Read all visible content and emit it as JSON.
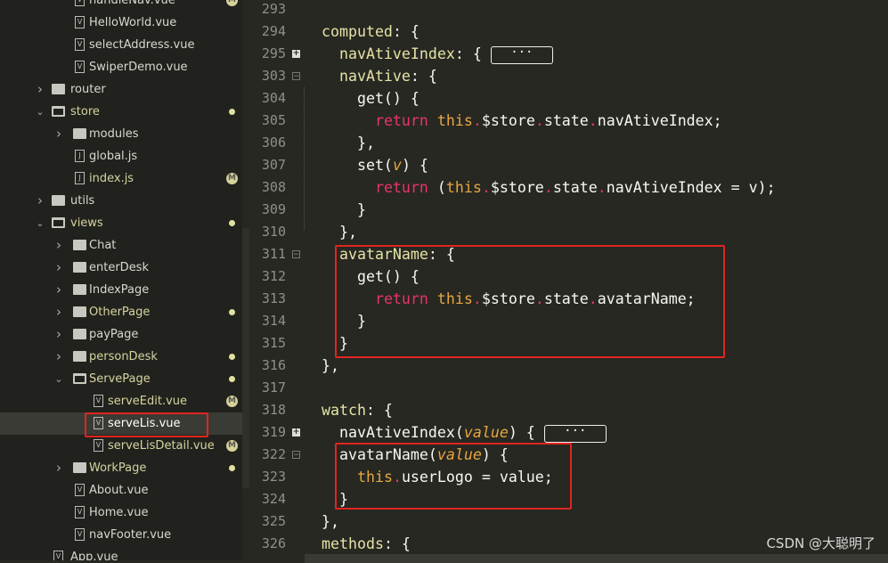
{
  "sidebar": {
    "items": [
      {
        "label": "handleNav.vue",
        "type": "file",
        "depth": 2,
        "badge": "M"
      },
      {
        "label": "HelloWorld.vue",
        "type": "file",
        "depth": 2
      },
      {
        "label": "selectAddress.vue",
        "type": "file",
        "depth": 2
      },
      {
        "label": "SwiperDemo.vue",
        "type": "file",
        "depth": 2
      },
      {
        "label": "router",
        "type": "folder",
        "depth": 1,
        "open": false
      },
      {
        "label": "store",
        "type": "folder",
        "depth": 1,
        "open": true,
        "badge": "dot",
        "modified": true
      },
      {
        "label": "modules",
        "type": "folder",
        "depth": 2,
        "open": false
      },
      {
        "label": "global.js",
        "type": "file",
        "depth": 2,
        "icon": "J"
      },
      {
        "label": "index.js",
        "type": "file",
        "depth": 2,
        "icon": "J",
        "badge": "M",
        "modified": true
      },
      {
        "label": "utils",
        "type": "folder",
        "depth": 1,
        "open": false
      },
      {
        "label": "views",
        "type": "folder",
        "depth": 1,
        "open": true,
        "badge": "dot",
        "modified": true
      },
      {
        "label": "Chat",
        "type": "folder",
        "depth": 2,
        "open": false
      },
      {
        "label": "enterDesk",
        "type": "folder",
        "depth": 2,
        "open": false
      },
      {
        "label": "IndexPage",
        "type": "folder",
        "depth": 2,
        "open": false
      },
      {
        "label": "OtherPage",
        "type": "folder",
        "depth": 2,
        "open": false,
        "badge": "dot",
        "modified": true
      },
      {
        "label": "payPage",
        "type": "folder",
        "depth": 2,
        "open": false
      },
      {
        "label": "personDesk",
        "type": "folder",
        "depth": 2,
        "open": false,
        "badge": "dot",
        "modified": true
      },
      {
        "label": "ServePage",
        "type": "folder",
        "depth": 2,
        "open": true,
        "badge": "dot",
        "modified": true
      },
      {
        "label": "serveEdit.vue",
        "type": "file",
        "depth": 3,
        "badge": "M",
        "modified": true
      },
      {
        "label": "serveLis.vue",
        "type": "file",
        "depth": 3,
        "selected": true
      },
      {
        "label": "serveLisDetail.vue",
        "type": "file",
        "depth": 3,
        "badge": "M",
        "modified": true
      },
      {
        "label": "WorkPage",
        "type": "folder",
        "depth": 2,
        "open": false,
        "badge": "dot",
        "modified": true
      },
      {
        "label": "About.vue",
        "type": "file",
        "depth": 2
      },
      {
        "label": "Home.vue",
        "type": "file",
        "depth": 2
      },
      {
        "label": "navFooter.vue",
        "type": "file",
        "depth": 2
      },
      {
        "label": "App.vue",
        "type": "file",
        "depth": 1
      }
    ]
  },
  "editor": {
    "lines": [
      {
        "n": "293",
        "tokens": []
      },
      {
        "n": "294",
        "tokens": [
          [
            "k",
            "computed"
          ],
          [
            "p",
            ": {"
          ]
        ]
      },
      {
        "n": "295",
        "fold": "plus",
        "collapsed": true,
        "tokens": [
          [
            "p",
            "  "
          ],
          [
            "k",
            "navAtiveIndex"
          ],
          [
            "p",
            ": {"
          ]
        ]
      },
      {
        "n": "303",
        "fold": "minus",
        "tokens": [
          [
            "p",
            "  "
          ],
          [
            "k",
            "navAtive"
          ],
          [
            "p",
            ": {"
          ]
        ]
      },
      {
        "n": "304",
        "tokens": [
          [
            "p",
            "    get() {"
          ]
        ]
      },
      {
        "n": "305",
        "tokens": [
          [
            "p",
            "      "
          ],
          [
            "kw",
            "return"
          ],
          [
            "p",
            " "
          ],
          [
            "th",
            "this"
          ],
          [
            "dt",
            "."
          ],
          [
            "p",
            "$store"
          ],
          [
            "dt",
            "."
          ],
          [
            "p",
            "state"
          ],
          [
            "dt",
            "."
          ],
          [
            "p",
            "navAtiveIndex;"
          ]
        ]
      },
      {
        "n": "306",
        "tokens": [
          [
            "p",
            "    },"
          ]
        ]
      },
      {
        "n": "307",
        "tokens": [
          [
            "p",
            "    set("
          ],
          [
            "it",
            "v"
          ],
          [
            "p",
            ") {"
          ]
        ]
      },
      {
        "n": "308",
        "tokens": [
          [
            "p",
            "      "
          ],
          [
            "kw",
            "return"
          ],
          [
            "p",
            " ("
          ],
          [
            "th",
            "this"
          ],
          [
            "dt",
            "."
          ],
          [
            "p",
            "$store"
          ],
          [
            "dt",
            "."
          ],
          [
            "p",
            "state"
          ],
          [
            "dt",
            "."
          ],
          [
            "p",
            "navAtiveIndex = v);"
          ]
        ]
      },
      {
        "n": "309",
        "tokens": [
          [
            "p",
            "    }"
          ]
        ]
      },
      {
        "n": "310",
        "tokens": [
          [
            "p",
            "  },"
          ]
        ]
      },
      {
        "n": "311",
        "fold": "minus",
        "tokens": [
          [
            "p",
            "  "
          ],
          [
            "k",
            "avatarName"
          ],
          [
            "p",
            ": {"
          ]
        ]
      },
      {
        "n": "312",
        "tokens": [
          [
            "p",
            "    get() {"
          ]
        ]
      },
      {
        "n": "313",
        "tokens": [
          [
            "p",
            "      "
          ],
          [
            "kw",
            "return"
          ],
          [
            "p",
            " "
          ],
          [
            "th",
            "this"
          ],
          [
            "dt",
            "."
          ],
          [
            "p",
            "$store"
          ],
          [
            "dt",
            "."
          ],
          [
            "p",
            "state"
          ],
          [
            "dt",
            "."
          ],
          [
            "p",
            "avatarName;"
          ]
        ]
      },
      {
        "n": "314",
        "tokens": [
          [
            "p",
            "    }"
          ]
        ]
      },
      {
        "n": "315",
        "tokens": [
          [
            "p",
            "  }"
          ]
        ]
      },
      {
        "n": "316",
        "tokens": [
          [
            "p",
            "},"
          ]
        ]
      },
      {
        "n": "317",
        "tokens": []
      },
      {
        "n": "318",
        "tokens": [
          [
            "k",
            "watch"
          ],
          [
            "p",
            ": {"
          ]
        ]
      },
      {
        "n": "319",
        "fold": "plus",
        "collapsed": true,
        "tokens": [
          [
            "p",
            "  navAtiveIndex("
          ],
          [
            "it",
            "value"
          ],
          [
            "p",
            ") {"
          ]
        ]
      },
      {
        "n": "322",
        "fold": "minus",
        "tokens": [
          [
            "p",
            "  avatarName("
          ],
          [
            "it",
            "value"
          ],
          [
            "p",
            ") {"
          ]
        ]
      },
      {
        "n": "323",
        "tokens": [
          [
            "p",
            "    "
          ],
          [
            "th",
            "this"
          ],
          [
            "dt",
            "."
          ],
          [
            "p",
            "userLogo = value;"
          ]
        ]
      },
      {
        "n": "324",
        "tokens": [
          [
            "p",
            "  }"
          ]
        ]
      },
      {
        "n": "325",
        "tokens": [
          [
            "p",
            "},"
          ]
        ]
      },
      {
        "n": "326",
        "tokens": [
          [
            "k",
            "methods"
          ],
          [
            "p",
            ": {"
          ]
        ]
      }
    ],
    "collapsed_label": "···"
  },
  "watermark": "CSDN @大聪明了",
  "colors": {
    "background": "#272822",
    "sidebar": "#21221d",
    "keyword": "#e8336e",
    "this": "#e8a640",
    "property": "#e6e2a6",
    "annotation": "#e0251e"
  }
}
